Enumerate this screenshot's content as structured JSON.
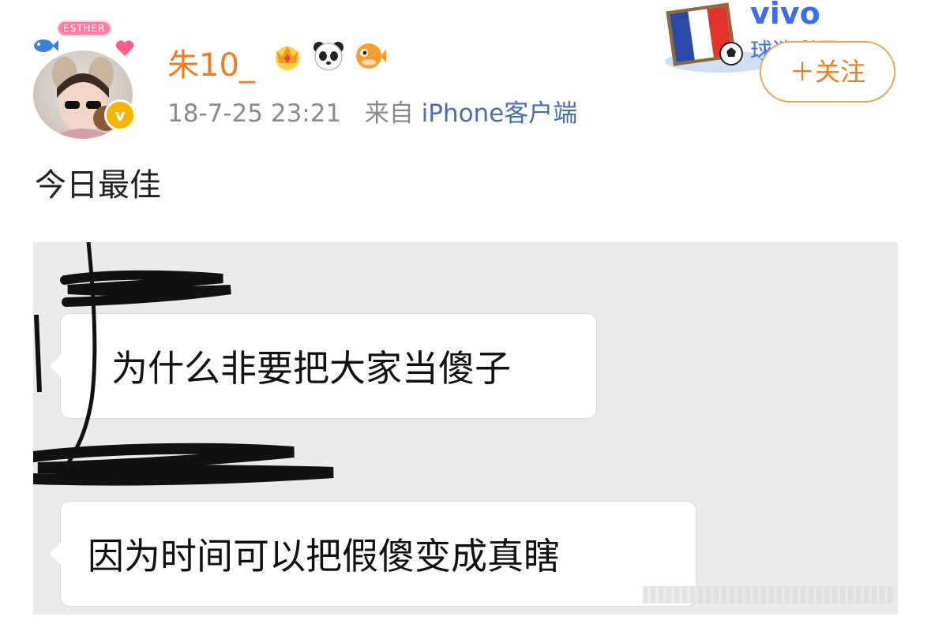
{
  "post": {
    "avatar_sign": "ESTHER",
    "username": "朱10_",
    "timestamp": "18-7-25 23:21",
    "source_prefix": "来自",
    "source": "iPhone客户端",
    "body": "今日最佳"
  },
  "ad_banner": {
    "brand": "vivo",
    "subtitle": "球迷彩蛋"
  },
  "follow_button": {
    "label": "＋关注"
  },
  "chat": {
    "messages": [
      {
        "text": "为什么非要把大家当傻子"
      },
      {
        "text": "因为时间可以把假傻变成真瞎"
      }
    ]
  },
  "icons": {
    "verified": "verified-v-icon",
    "badges": [
      "crown-badge-icon",
      "panda-badge-icon",
      "pufferfish-badge-icon"
    ]
  },
  "colors": {
    "username": "#f37a1f",
    "source_link": "#4a6ea8",
    "meta": "#8a8a8a",
    "follow_border": "#f0a455",
    "vivo_blue": "#3a6df0",
    "verified": "#f6b400",
    "chat_bg": "#ebebeb"
  }
}
